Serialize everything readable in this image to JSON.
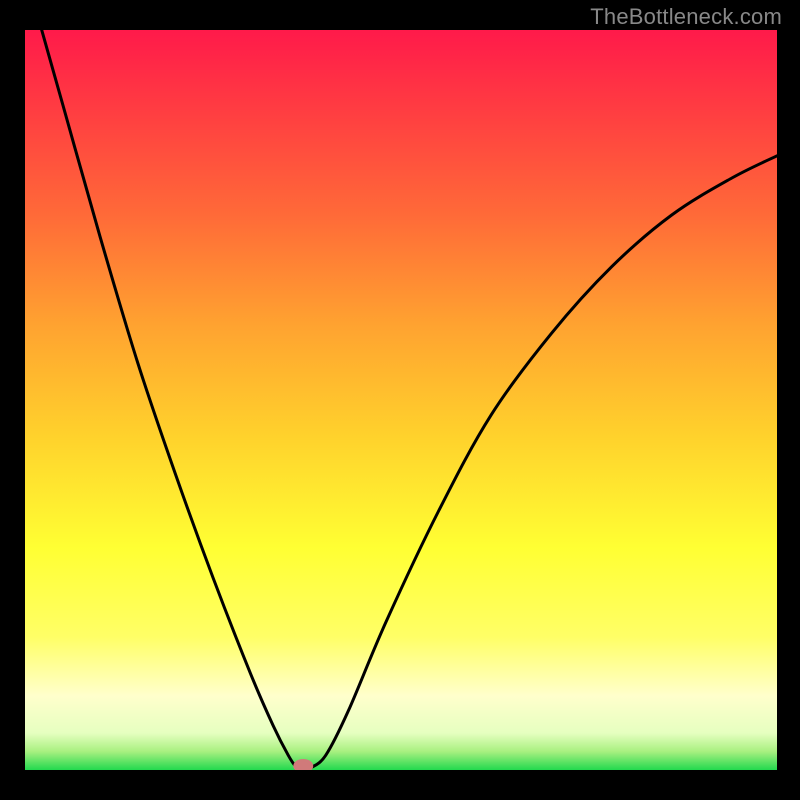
{
  "watermark": "TheBottleneck.com",
  "chart_data": {
    "type": "line",
    "title": "",
    "xlabel": "",
    "ylabel": "",
    "xlim": [
      0,
      100
    ],
    "ylim": [
      0,
      100
    ],
    "gradient_stops": [
      {
        "offset": 0.0,
        "color": "#ff1a4a"
      },
      {
        "offset": 0.1,
        "color": "#ff3a42"
      },
      {
        "offset": 0.25,
        "color": "#ff6a38"
      },
      {
        "offset": 0.4,
        "color": "#ffa330"
      },
      {
        "offset": 0.55,
        "color": "#ffd22c"
      },
      {
        "offset": 0.7,
        "color": "#ffff33"
      },
      {
        "offset": 0.82,
        "color": "#ffff66"
      },
      {
        "offset": 0.9,
        "color": "#ffffcc"
      },
      {
        "offset": 0.95,
        "color": "#e6ffc0"
      },
      {
        "offset": 0.975,
        "color": "#a8f080"
      },
      {
        "offset": 1.0,
        "color": "#22d94e"
      }
    ],
    "curve": {
      "minimum_x": 37,
      "points": [
        {
          "x": 0,
          "y": 108
        },
        {
          "x": 5,
          "y": 90
        },
        {
          "x": 10,
          "y": 72
        },
        {
          "x": 15,
          "y": 55
        },
        {
          "x": 20,
          "y": 40
        },
        {
          "x": 25,
          "y": 26
        },
        {
          "x": 30,
          "y": 13
        },
        {
          "x": 33,
          "y": 6
        },
        {
          "x": 35,
          "y": 2
        },
        {
          "x": 36,
          "y": 0.5
        },
        {
          "x": 37,
          "y": 0
        },
        {
          "x": 38,
          "y": 0.3
        },
        {
          "x": 40,
          "y": 2
        },
        {
          "x": 43,
          "y": 8
        },
        {
          "x": 48,
          "y": 20
        },
        {
          "x": 55,
          "y": 35
        },
        {
          "x": 62,
          "y": 48
        },
        {
          "x": 70,
          "y": 59
        },
        {
          "x": 78,
          "y": 68
        },
        {
          "x": 86,
          "y": 75
        },
        {
          "x": 94,
          "y": 80
        },
        {
          "x": 100,
          "y": 83
        }
      ]
    },
    "marker": {
      "x": 37,
      "y": 0,
      "color": "#d07a7a"
    }
  }
}
